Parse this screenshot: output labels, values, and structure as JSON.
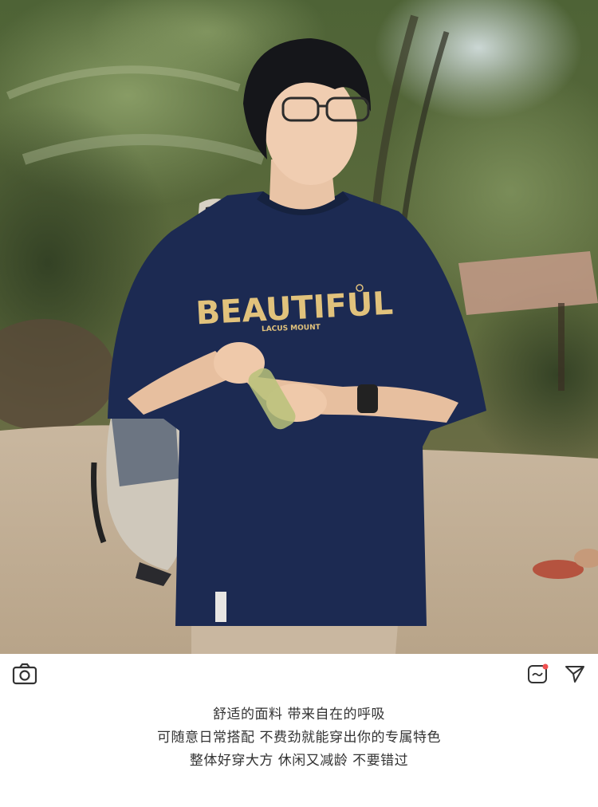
{
  "photo": {
    "shirt_print": "BEAUTIFUL",
    "shirt_subprint": "LACUS MOUNT",
    "print_color": "#e1c27c",
    "shirt_color": "#1c2a52"
  },
  "toolbar": {
    "left_icon": "camera-icon",
    "right_icons": [
      "sticker-icon",
      "send-icon"
    ],
    "notification_dot_color": "#f05050"
  },
  "caption": {
    "lines": [
      "舒适的面料 带来自在的呼吸",
      "可随意日常搭配 不费劲就能穿出你的专属特色",
      "整体好穿大方 休闲又减龄 不要错过"
    ]
  }
}
